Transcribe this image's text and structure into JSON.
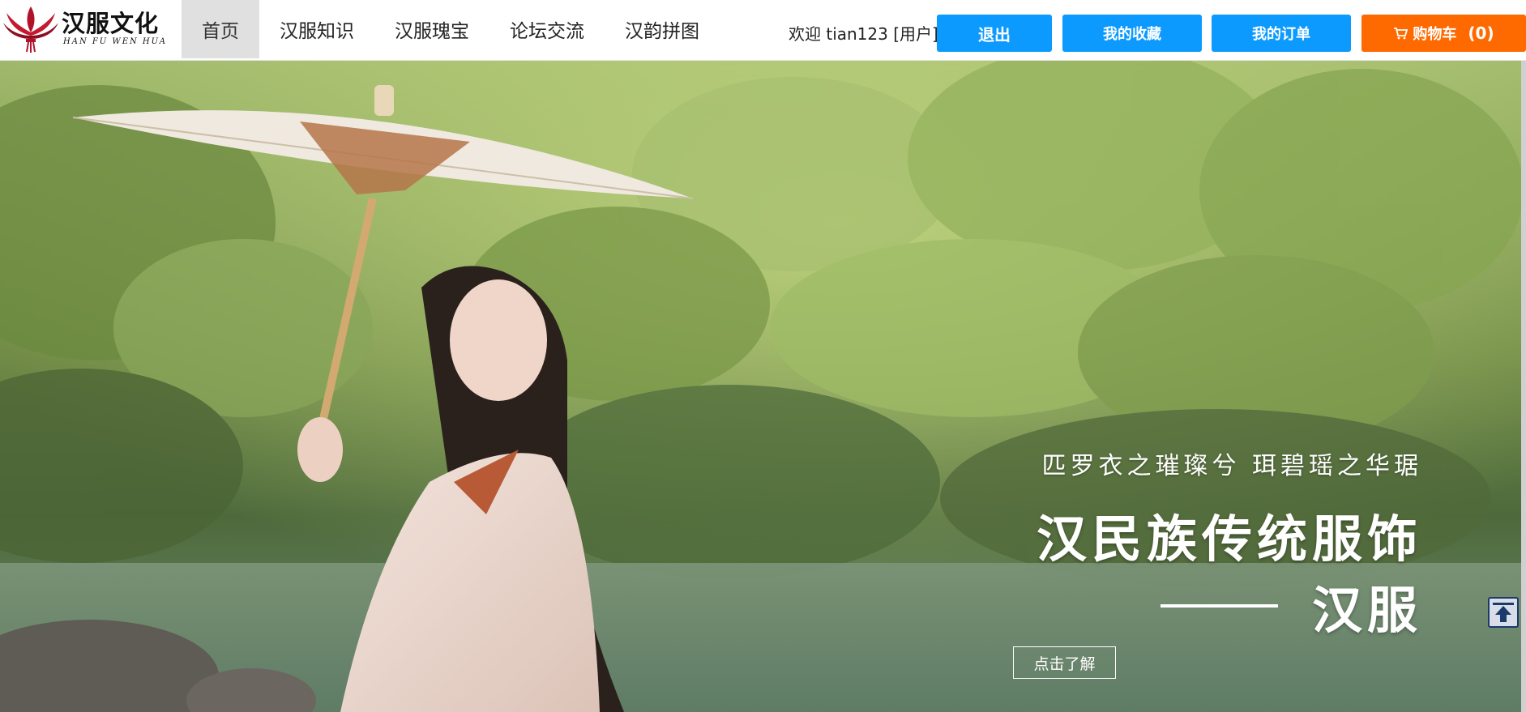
{
  "logo": {
    "title": "汉服文化",
    "subtitle": "HAN FU WEN HUA"
  },
  "nav": {
    "items": [
      {
        "label": "首页",
        "active": true
      },
      {
        "label": "汉服知识",
        "active": false
      },
      {
        "label": "汉服瑰宝",
        "active": false
      },
      {
        "label": "论坛交流",
        "active": false
      },
      {
        "label": "汉韵拼图",
        "active": false
      }
    ]
  },
  "user": {
    "welcome": "欢迎 tian123 [用户]"
  },
  "buttons": {
    "logout": "退出",
    "favorites": "我的收藏",
    "orders": "我的订单",
    "cart_label": "购物车",
    "cart_count": "(0)"
  },
  "hero": {
    "poem": "匹罗衣之璀璨兮  珥碧瑶之华琚",
    "title_line1": "汉民族传统服饰",
    "title_line2": "汉服",
    "learn_more": "点击了解"
  },
  "colors": {
    "primary_button": "#0d9aff",
    "cart_button": "#ff6a00",
    "active_nav_bg": "#e0e0e0"
  },
  "icons": {
    "cart": "cart-icon",
    "back_to_top": "arrow-up-icon",
    "logo": "lotus-logo-icon"
  }
}
